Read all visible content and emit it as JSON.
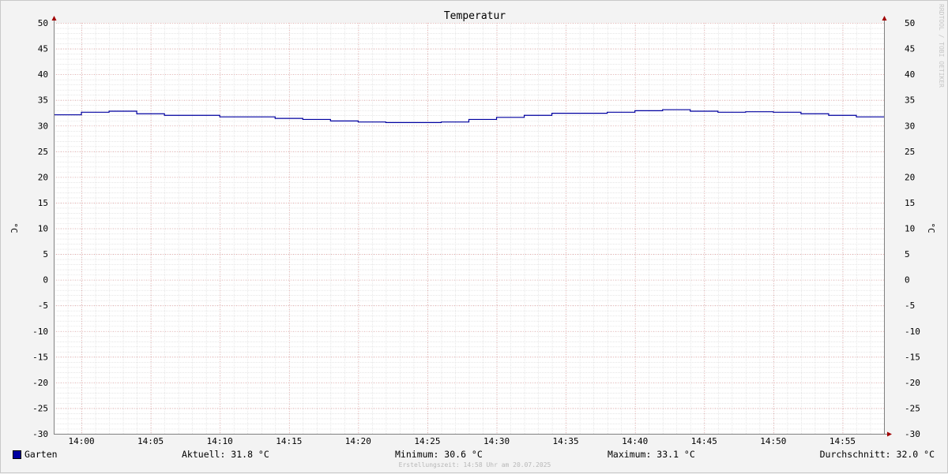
{
  "chart_data": {
    "type": "line",
    "title": "Temperatur",
    "ylabel_left": "°C",
    "ylabel_right": "°C",
    "ylim": [
      -30,
      50
    ],
    "yticks": [
      50,
      45,
      40,
      35,
      30,
      25,
      20,
      15,
      10,
      5,
      0,
      -5,
      -10,
      -15,
      -20,
      -25,
      -30
    ],
    "xlim": [
      "13:58",
      "14:58"
    ],
    "xticks": [
      "14:00",
      "14:05",
      "14:10",
      "14:15",
      "14:20",
      "14:25",
      "14:30",
      "14:35",
      "14:40",
      "14:45",
      "14:50",
      "14:55"
    ],
    "grid": true,
    "series": [
      {
        "name": "Garten",
        "color": "#0000a0",
        "step": true,
        "points": [
          [
            "13:58",
            32.1
          ],
          [
            "14:00",
            32.6
          ],
          [
            "14:02",
            32.8
          ],
          [
            "14:04",
            32.3
          ],
          [
            "14:06",
            32.0
          ],
          [
            "14:10",
            31.7
          ],
          [
            "14:14",
            31.4
          ],
          [
            "14:16",
            31.2
          ],
          [
            "14:18",
            30.9
          ],
          [
            "14:20",
            30.7
          ],
          [
            "14:22",
            30.6
          ],
          [
            "14:26",
            30.7
          ],
          [
            "14:28",
            31.2
          ],
          [
            "14:30",
            31.6
          ],
          [
            "14:32",
            32.0
          ],
          [
            "14:34",
            32.4
          ],
          [
            "14:38",
            32.6
          ],
          [
            "14:40",
            32.9
          ],
          [
            "14:42",
            33.1
          ],
          [
            "14:44",
            32.8
          ],
          [
            "14:46",
            32.6
          ],
          [
            "14:48",
            32.7
          ],
          [
            "14:50",
            32.6
          ],
          [
            "14:52",
            32.3
          ],
          [
            "14:54",
            32.0
          ],
          [
            "14:56",
            31.7
          ],
          [
            "14:58",
            31.7
          ]
        ]
      }
    ]
  },
  "legend": {
    "series_name": "Garten",
    "aktuell": "Aktuell: 31.8 °C",
    "minimum": "Minimum: 30.6 °C",
    "maximum": "Maximum: 33.1 °C",
    "durchschnitt": "Durchschnitt: 32.0 °C"
  },
  "footer": "Erstellungszeit: 14:58 Uhr am 20.07.2025",
  "watermark": "RRDTOOL / TOBI OETIKER",
  "colors": {
    "line": "#0000a0",
    "major_grid": "#e8a8a8",
    "minor_grid": "#d8d8d8",
    "axis": "#808080",
    "arrow": "#a00000",
    "plot_bg": "#ffffff"
  }
}
